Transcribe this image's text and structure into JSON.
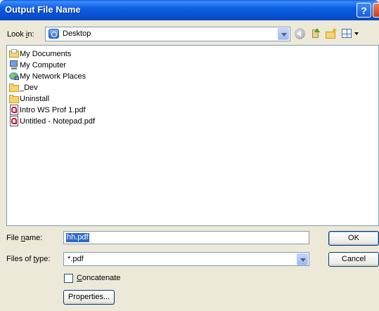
{
  "window": {
    "title": "Output File Name"
  },
  "look_in": {
    "label_pre": "Look ",
    "label_key": "i",
    "label_post": "n:",
    "value": "Desktop"
  },
  "files": [
    {
      "name": "My Documents",
      "icon": "my-documents-icon"
    },
    {
      "name": "My Computer",
      "icon": "my-computer-icon"
    },
    {
      "name": "My Network Places",
      "icon": "network-places-icon"
    },
    {
      "name": "_Dev",
      "icon": "folder-icon"
    },
    {
      "name": "Uninstall",
      "icon": "folder-icon"
    },
    {
      "name": "Intro WS Prof 1.pdf",
      "icon": "pdf-file-icon"
    },
    {
      "name": "Untitled - Notepad.pdf",
      "icon": "pdf-file-icon"
    }
  ],
  "file_name": {
    "label_pre": "File ",
    "label_key": "n",
    "label_post": "ame:",
    "value": "hh.pdf"
  },
  "file_type": {
    "label_pre": "Files of ",
    "label_key": "t",
    "label_post": "ype:",
    "value": "*.pdf"
  },
  "buttons": {
    "ok": "OK",
    "cancel": "Cancel",
    "properties": "Properties..."
  },
  "concatenate": {
    "label_key": "C",
    "label_rest": "oncatenate",
    "checked": false
  }
}
